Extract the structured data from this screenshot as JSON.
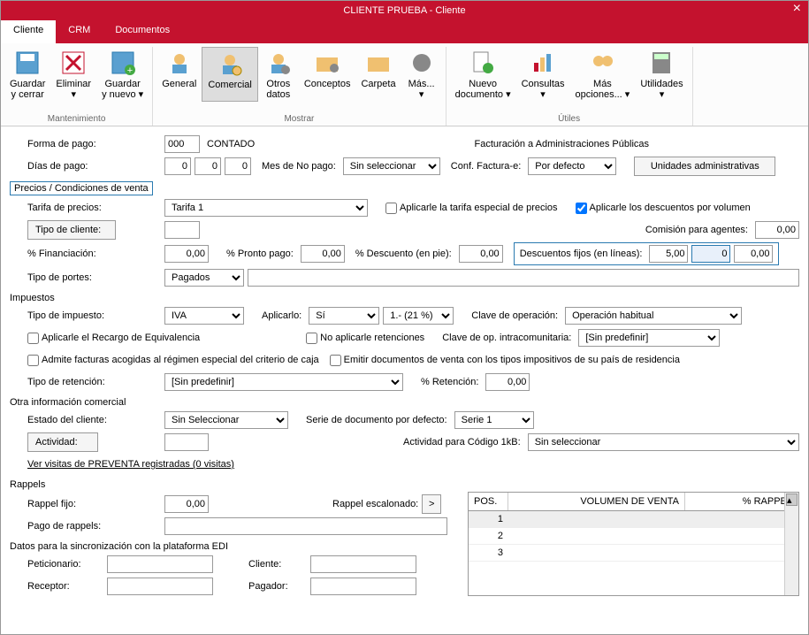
{
  "title": "CLIENTE PRUEBA - Cliente",
  "tabs": {
    "cliente": "Cliente",
    "crm": "CRM",
    "documentos": "Documentos"
  },
  "ribbon": {
    "guardar_cerrar": "Guardar\ny cerrar",
    "eliminar": "Eliminar\n▾",
    "guardar_nuevo": "Guardar\ny nuevo ▾",
    "general": "General",
    "comercial": "Comercial",
    "otros_datos": "Otros\ndatos",
    "conceptos": "Conceptos",
    "carpeta": "Carpeta",
    "mas": "Más...\n▾",
    "nuevo_doc": "Nuevo\ndocumento ▾",
    "consultas": "Consultas\n▾",
    "mas_op": "Más\nopciones... ▾",
    "utilidades": "Utilidades\n▾",
    "grp_mant": "Mantenimiento",
    "grp_mostrar": "Mostrar",
    "grp_utiles": "Útiles"
  },
  "f": {
    "forma_pago_lbl": "Forma de pago:",
    "forma_pago_val": "000",
    "forma_pago_txt": "CONTADO",
    "fact_admin": "Facturación a Administraciones Públicas",
    "dias_pago_lbl": "Días de pago:",
    "dias_pago_1": "0",
    "dias_pago_2": "0",
    "dias_pago_3": "0",
    "mes_no_pago_lbl": "Mes de No pago:",
    "mes_no_pago_val": "Sin seleccionar",
    "conf_fact_lbl": "Conf. Factura-e:",
    "conf_fact_val": "Por defecto",
    "unid_admin": "Unidades administrativas",
    "precios_hdr": "Precios / Condiciones de venta",
    "tarifa_lbl": "Tarifa de precios:",
    "tarifa_val": "Tarifa 1",
    "tarifa_esp": "Aplicarle la tarifa especial de precios",
    "desc_vol": "Aplicarle los descuentos por volumen",
    "tipo_cliente_lbl": "Tipo de cliente:",
    "tipo_cliente_val": "",
    "comision_lbl": "Comisión para agentes:",
    "comision_val": "0,00",
    "financiacion_lbl": "% Financiación:",
    "financiacion_val": "0,00",
    "pronto_pago_lbl": "% Pronto pago:",
    "pronto_pago_val": "0,00",
    "desc_pie_lbl": "% Descuento (en pie):",
    "desc_pie_val": "0,00",
    "desc_fijos_lbl": "Descuentos fijos (en líneas):",
    "desc_fijos_1": "5,00",
    "desc_fijos_2": "0",
    "desc_fijos_3": "0,00",
    "tipo_portes_lbl": "Tipo de portes:",
    "tipo_portes_val": "Pagados",
    "impuestos_hdr": "Impuestos",
    "tipo_imp_lbl": "Tipo de impuesto:",
    "tipo_imp_val": "IVA",
    "aplicarlo_lbl": "Aplicarlo:",
    "aplicarlo_val": "Sí",
    "iva_val": "1.- (21 %)",
    "clave_op_lbl": "Clave de operación:",
    "clave_op_val": "Operación habitual",
    "recargo": "Aplicarle el Recargo de Equivalencia",
    "no_ret": "No aplicarle retenciones",
    "clave_intra_lbl": "Clave de op. intracomunitaria:",
    "clave_intra_val": "[Sin predefinir]",
    "criterio_caja": "Admite facturas acogidas al régimen especial del criterio de caja",
    "emitir_doc": "Emitir documentos de venta con los tipos impositivos de su país de residencia",
    "tipo_ret_lbl": "Tipo de retención:",
    "tipo_ret_val": "[Sin predefinir]",
    "pct_ret_lbl": "% Retención:",
    "pct_ret_val": "0,00",
    "otra_info_hdr": "Otra información comercial",
    "estado_lbl": "Estado del cliente:",
    "estado_val": "Sin Seleccionar",
    "serie_lbl": "Serie de documento por defecto:",
    "serie_val": "Serie 1",
    "actividad_lbl": "Actividad:",
    "actividad_val": "",
    "act_1kb_lbl": "Actividad para Código 1kB:",
    "act_1kb_val": "Sin seleccionar",
    "visitas_link": "Ver visitas de PREVENTA registradas (0 visitas)",
    "rappels_hdr": "Rappels",
    "rappel_fijo_lbl": "Rappel fijo:",
    "rappel_fijo_val": "0,00",
    "rappel_esc_lbl": "Rappel escalonado:",
    "pago_rappels_lbl": "Pago de rappels:",
    "pago_rappels_val": "",
    "edi_hdr": "Datos para la sincronización con la plataforma EDI",
    "peticionario_lbl": "Peticionario:",
    "cliente_lbl": "Cliente:",
    "receptor_lbl": "Receptor:",
    "pagador_lbl": "Pagador:",
    "tbl_pos": "POS.",
    "tbl_vol": "VOLUMEN DE VENTA",
    "tbl_rap": "% RAPPEL",
    "r1": "1",
    "r2": "2",
    "r3": "3"
  }
}
